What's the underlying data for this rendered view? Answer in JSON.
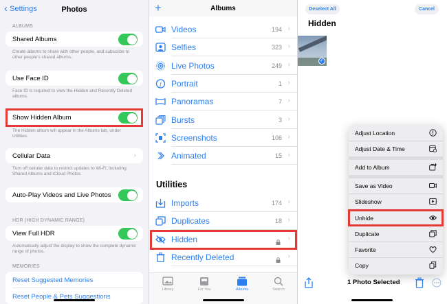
{
  "settings": {
    "back_label": "Settings",
    "title": "Photos",
    "albums_header": "ALBUMS",
    "shared_albums": "Shared Albums",
    "shared_albums_note": "Create albums to share with other people, and subscribe to other people's shared albums.",
    "face_id": "Use Face ID",
    "face_id_note": "Face ID is required to view the Hidden and Recently Deleted albums.",
    "show_hidden": "Show Hidden Album",
    "show_hidden_note": "The Hidden album will appear in the Albums tab, under Utilities.",
    "cellular": "Cellular Data",
    "cellular_note": "Turn off cellular data to restrict updates to Wi-Fi, including Shared Albums and iCloud Photos.",
    "autoplay": "Auto-Play Videos and Live Photos",
    "hdr_header": "HDR (HIGH DYNAMIC RANGE)",
    "full_hdr": "View Full HDR",
    "full_hdr_note": "Automatically adjust the display to show the complete dynamic range of photos.",
    "memories_header": "MEMORIES",
    "reset_memories": "Reset Suggested Memories",
    "reset_people": "Reset People & Pets Suggestions"
  },
  "albums": {
    "title": "Albums",
    "media_types": [
      {
        "label": "Videos",
        "count": "194",
        "icon": "video-icon"
      },
      {
        "label": "Selfies",
        "count": "323",
        "icon": "selfie-icon"
      },
      {
        "label": "Live Photos",
        "count": "249",
        "icon": "live-photo-icon"
      },
      {
        "label": "Portrait",
        "count": "1",
        "icon": "portrait-icon"
      },
      {
        "label": "Panoramas",
        "count": "7",
        "icon": "panorama-icon"
      },
      {
        "label": "Bursts",
        "count": "3",
        "icon": "burst-icon"
      },
      {
        "label": "Screenshots",
        "count": "106",
        "icon": "screenshot-icon"
      },
      {
        "label": "Animated",
        "count": "15",
        "icon": "animated-icon"
      }
    ],
    "utilities_header": "Utilities",
    "utilities": [
      {
        "label": "Imports",
        "count": "174",
        "icon": "import-icon"
      },
      {
        "label": "Duplicates",
        "count": "18",
        "icon": "duplicate-icon"
      },
      {
        "label": "Hidden",
        "count": "",
        "icon": "hidden-eye-icon"
      },
      {
        "label": "Recently Deleted",
        "count": "",
        "icon": "trash-icon"
      }
    ],
    "tabs": [
      {
        "label": "Library",
        "icon": "library-icon"
      },
      {
        "label": "For You",
        "icon": "for-you-icon"
      },
      {
        "label": "Albums",
        "icon": "albums-icon",
        "active": true
      },
      {
        "label": "Search",
        "icon": "search-icon"
      }
    ]
  },
  "hidden": {
    "deselect_all": "Deselect All",
    "cancel": "Cancel",
    "title": "Hidden",
    "menu": [
      {
        "label": "Adjust Location",
        "icon": "location-info-icon"
      },
      {
        "label": "Adjust Date & Time",
        "icon": "calendar-icon"
      },
      {
        "label": "Add to Album",
        "icon": "add-album-icon"
      },
      {
        "label": "Save as Video",
        "icon": "video-icon"
      },
      {
        "label": "Slideshow",
        "icon": "play-icon"
      },
      {
        "label": "Unhide",
        "icon": "eye-icon"
      },
      {
        "label": "Duplicate",
        "icon": "duplicate-icon"
      },
      {
        "label": "Favorite",
        "icon": "heart-icon"
      },
      {
        "label": "Copy",
        "icon": "copy-icon"
      }
    ],
    "selection_count": "1 Photo Selected"
  },
  "colors": {
    "accent": "#2b7ff0",
    "toggle_on": "#34c759",
    "highlight": "#e53935"
  }
}
